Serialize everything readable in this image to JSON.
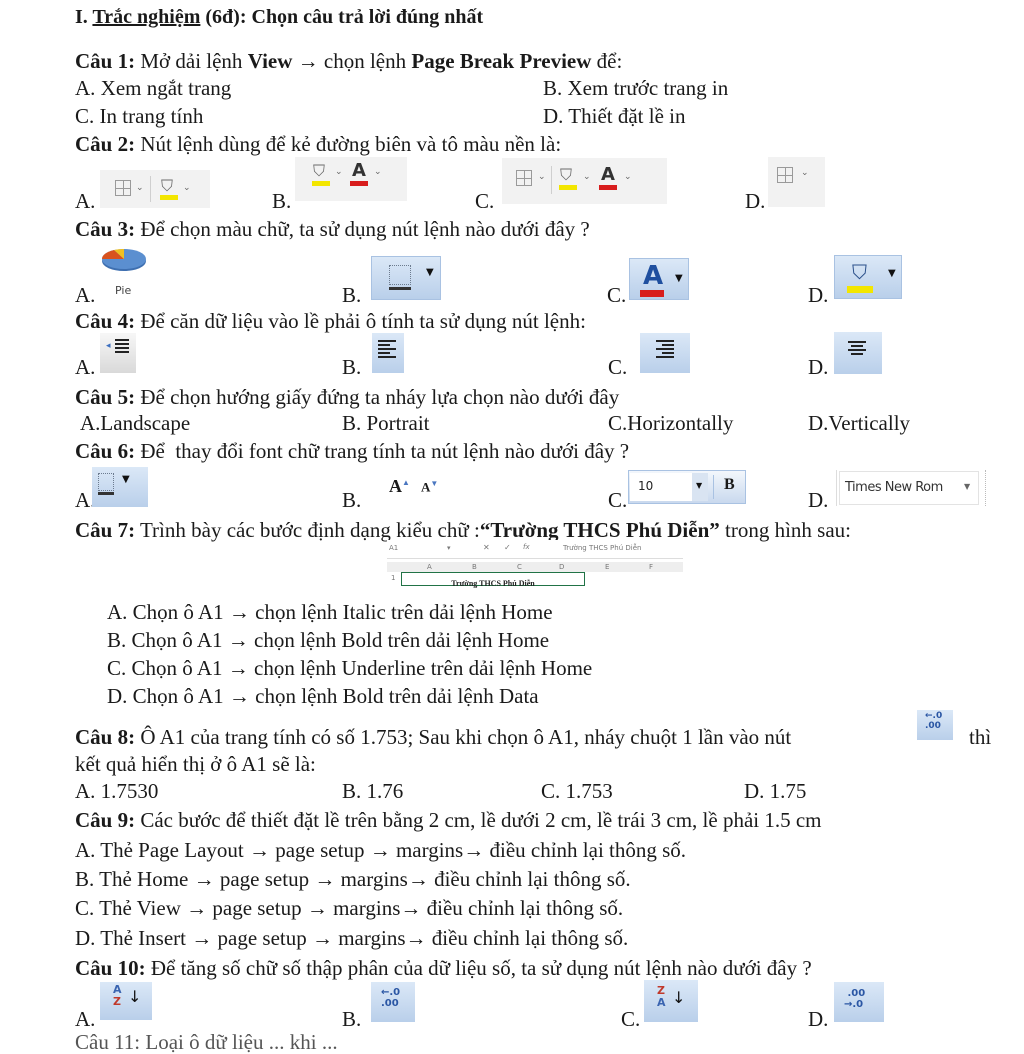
{
  "section_title": {
    "roman": "I.",
    "name": "Trắc nghiệm",
    "rest": " (6đ): Chọn câu trả lời đúng nhất"
  },
  "q1": {
    "label": "Câu 1:",
    "text_a": " Mở dải lệnh ",
    "view": "View",
    "arrow": " → ",
    "text_b": "chọn lệnh ",
    "page_break": "Page Break Preview",
    "text_c": " để:",
    "options": [
      "A. Xem ngắt trang",
      "B. Xem trước trang in",
      "C. In trang tính",
      "D. Thiết đặt lề in"
    ]
  },
  "q2": {
    "label": "Câu 2:",
    "text": " Nút lệnh dùng để kẻ đường biên và tô màu nền là:",
    "option_letters": [
      "A.",
      "B.",
      "C.",
      "D."
    ],
    "option_icons": [
      [
        "borders-dropdown-icon",
        "fill-color-dropdown-icon"
      ],
      [
        "fill-color-dropdown-icon",
        "font-color-dropdown-icon"
      ],
      [
        "borders-dropdown-icon",
        "fill-color-dropdown-icon",
        "font-color-dropdown-icon"
      ],
      [
        "borders-dropdown-icon"
      ]
    ]
  },
  "q3": {
    "label": "Câu 3:",
    "text": " Để chọn màu chữ, ta sử dụng nút lệnh nào dưới đây ?",
    "option_letters": [
      "A.",
      "B.",
      "C.",
      "D."
    ],
    "pie_label": "Pie",
    "option_icons": [
      "pie-chart-icon",
      "borders-dropdown-icon",
      "font-color-dropdown-icon",
      "fill-color-dropdown-icon"
    ]
  },
  "q4": {
    "label": "Câu 4:",
    "text": " Để căn dữ liệu vào lề phải ô tính ta sử dụng nút lệnh:",
    "option_letters": [
      "A.",
      "B.",
      "C.",
      "D."
    ],
    "option_icons": [
      "decrease-indent-icon",
      "align-left-icon",
      "align-right-icon",
      "align-center-icon"
    ]
  },
  "q5": {
    "label": "Câu 5:",
    "text": " Để chọn hướng giấy đứng ta nháy lựa chọn nào dưới đây",
    "options": [
      "A.Landscape",
      "B. Portrait",
      "C.Horizontally",
      "D.Vertically"
    ]
  },
  "q6": {
    "label": "Câu 6:",
    "text": " Để  thay đổi font chữ trang tính ta nút lệnh nào dưới đây ?",
    "option_letters": [
      "A.",
      "B.",
      "C.",
      "D."
    ],
    "font_size_value": "10",
    "bold_label": "B",
    "font_name_value": "Times New Rom",
    "grow_font": "A",
    "shrink_font": "A"
  },
  "q7": {
    "label": "Câu 7:",
    "text_a": " Trình bày các bước định dạng kiểu chữ :",
    "quote": "“Trường THCS Phú Diễn”",
    "text_b": " trong hình sau:",
    "excel": {
      "name_box": "A1",
      "formula_value": "Trường THCS Phú Diễn",
      "fx": "fx",
      "columns": [
        "A",
        "B",
        "C",
        "D",
        "E",
        "F"
      ],
      "row_number": "1",
      "cell_text": "Trường THCS Phú Diễn"
    },
    "options": [
      "A. Chọn ô A1 → chọn lệnh Italic trên dải lệnh Home",
      "B. Chọn ô A1 → chọn lệnh Bold trên dải lệnh Home",
      "C. Chọn ô A1 → chọn lệnh Underline trên dải lệnh Home",
      "D. Chọn ô A1 → chọn lệnh Bold trên dải lệnh Data"
    ]
  },
  "q8": {
    "label": "Câu 8:",
    "text_a": " Ô A1 của trang tính có số 1.753; Sau khi chọn ô A1, nháy chuột 1 lần vào nút",
    "text_b": "thì",
    "text_c": "kết quả hiển thị ở ô A1 sẽ là:",
    "options": [
      "A. 1.7530",
      "B. 1.76",
      "C. 1.753",
      "D. 1.75"
    ]
  },
  "q9": {
    "label": "Câu 9:",
    "text": " Các bước để thiết đặt lề trên bằng 2 cm, lề dưới 2 cm, lề trái 3 cm, lề phải 1.5 cm",
    "options": [
      "A. Thẻ Page Layout → page setup → margins→ điều chỉnh lại thông số.",
      "B. Thẻ Home → page setup → margins→ điều chỉnh lại thông số.",
      "C. Thẻ View → page setup → margins→ điều chỉnh lại thông số.",
      "D. Thẻ Insert → page setup → margins→ điều chỉnh lại thông số."
    ]
  },
  "q10": {
    "label": "Câu 10:",
    "text": " Để tăng số chữ số thập phân của dữ liệu số, ta sử dụng nút lệnh nào dưới đây ?",
    "option_letters": [
      "A.",
      "B.",
      "C.",
      "D."
    ],
    "option_icons": [
      "sort-a-to-z-icon",
      "increase-decimal-icon",
      "sort-z-to-a-icon",
      "decrease-decimal-icon"
    ]
  },
  "q11_partial": "Câu 11: Loại ô dữ liệu ... khi ..."
}
